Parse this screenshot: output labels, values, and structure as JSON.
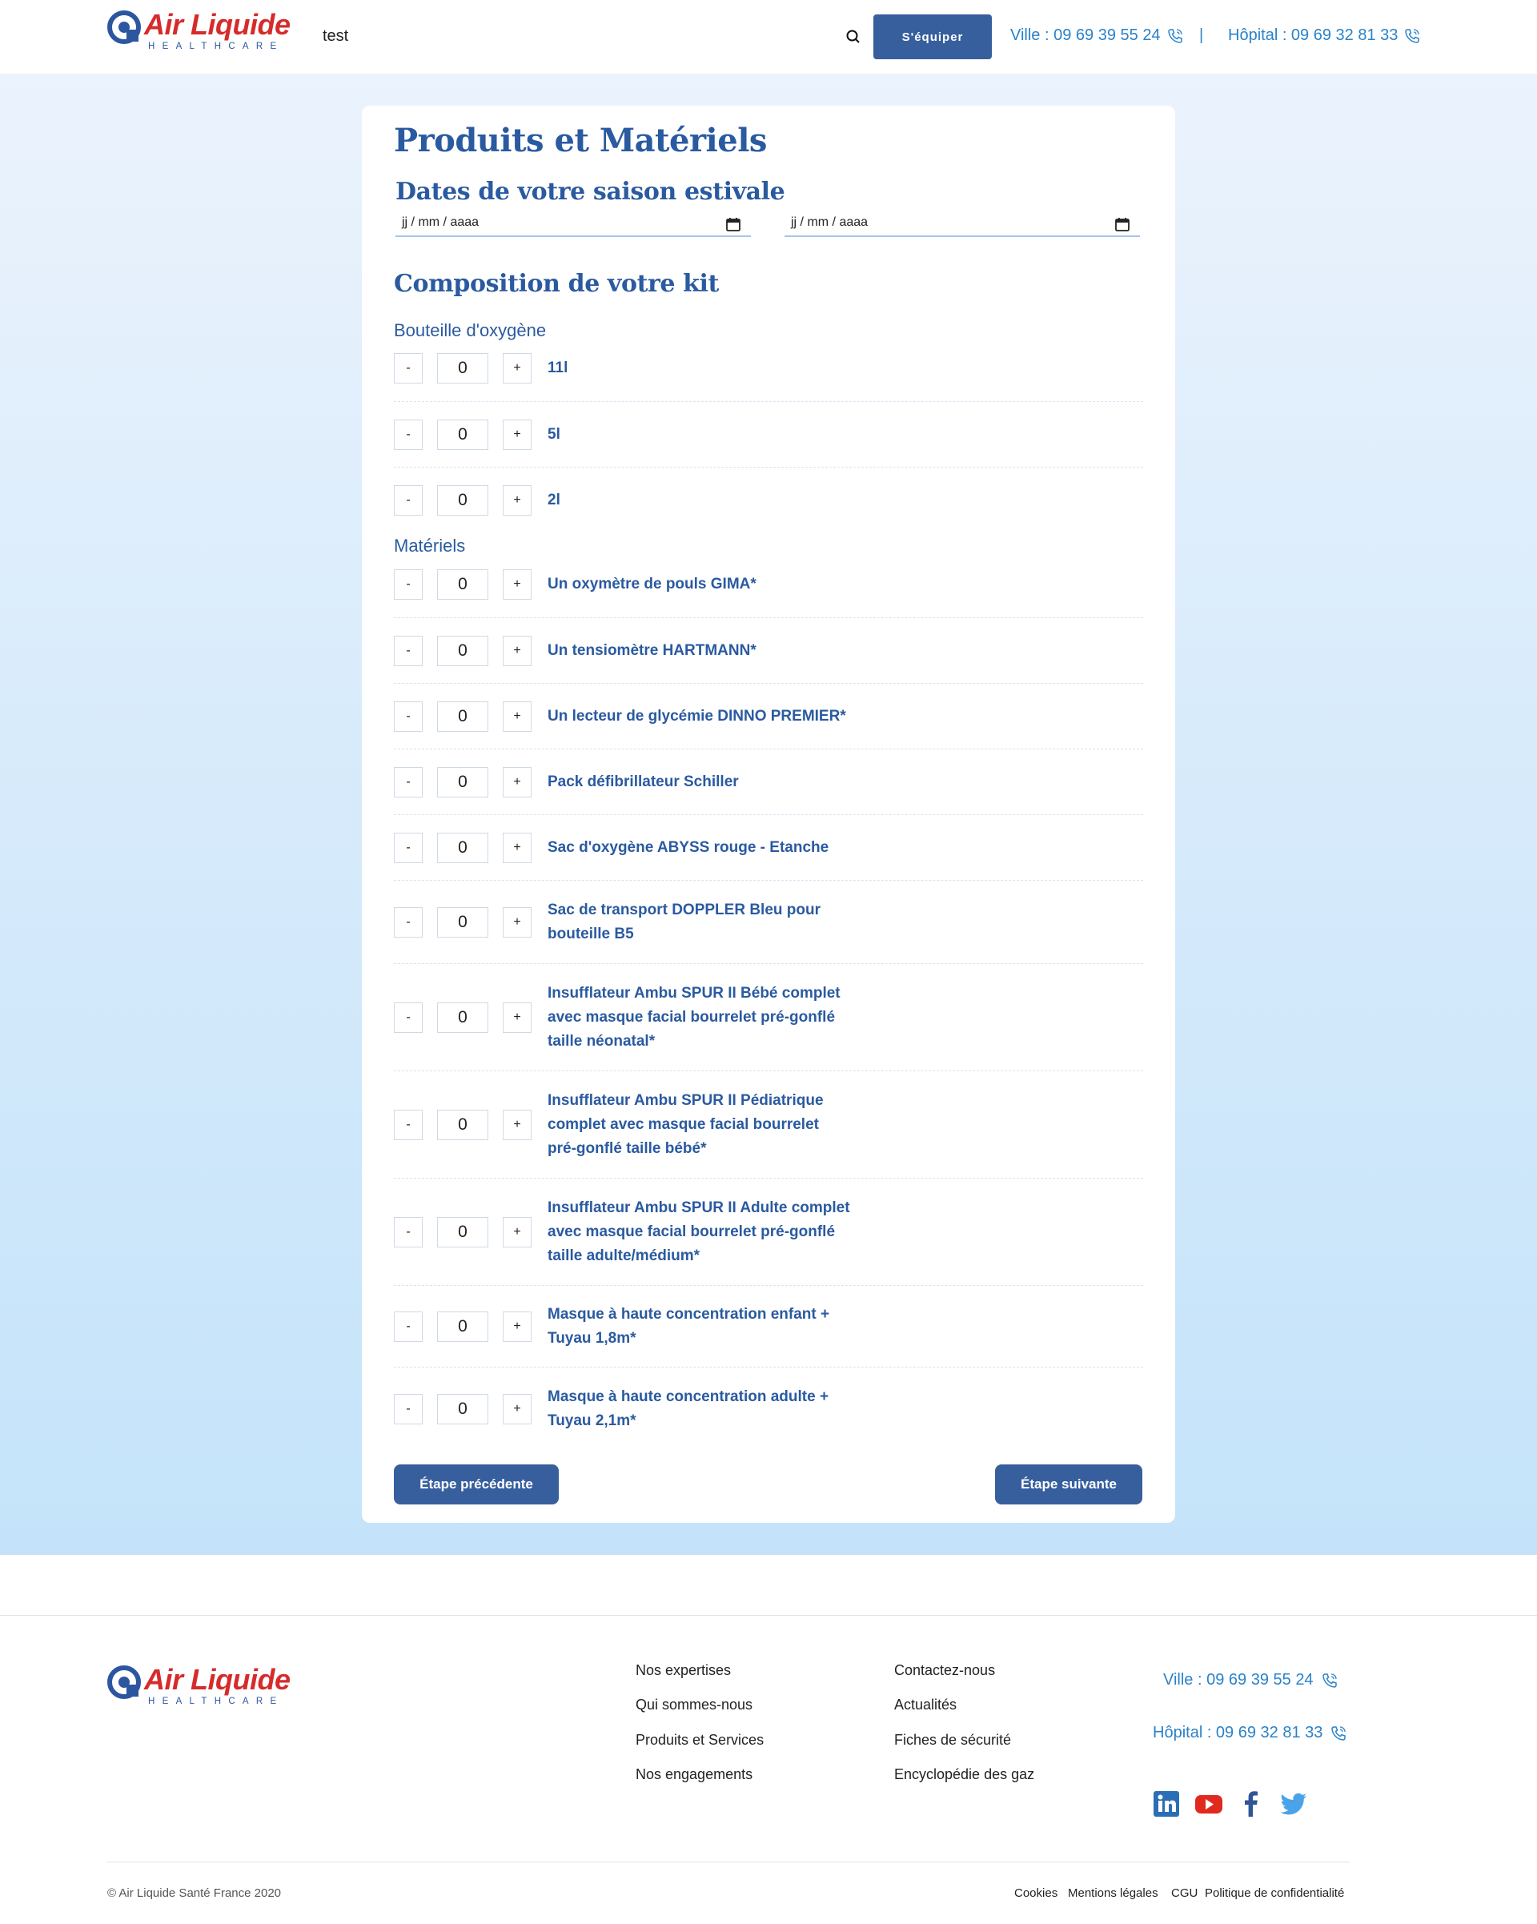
{
  "header": {
    "logo_name": "Air Liquide",
    "logo_sub": "HEALTHCARE",
    "test_label": "test",
    "equip_button": "S'équiper",
    "phone_ville": "Ville : 09 69 39 55 24",
    "separator": "|",
    "phone_hopital": "Hôpital : 09 69 32 81 33"
  },
  "form": {
    "title": "Produits et Matériels",
    "dates_title": "Dates de votre saison estivale",
    "date_start_placeholder": "jj / mm / aaaa",
    "date_end_placeholder": "jj / mm / aaaa",
    "kit_title": "Composition de votre kit",
    "oxygen_group": "Bouteille d'oxygène",
    "materials_group": "Matériels",
    "minus": "-",
    "plus": "+",
    "oxygen": [
      {
        "qty": "0",
        "label": "11l"
      },
      {
        "qty": "0",
        "label": "5l"
      },
      {
        "qty": "0",
        "label": "2l"
      }
    ],
    "materials": [
      {
        "qty": "0",
        "label": "Un oxymètre de pouls GIMA*"
      },
      {
        "qty": "0",
        "label": "Un tensiomètre HARTMANN*"
      },
      {
        "qty": "0",
        "label": "Un lecteur de glycémie DINNO PREMIER*"
      },
      {
        "qty": "0",
        "label": "Pack défibrillateur Schiller"
      },
      {
        "qty": "0",
        "label": "Sac d'oxygène ABYSS rouge - Etanche"
      },
      {
        "qty": "0",
        "label": "Sac de transport DOPPLER Bleu pour bouteille B5"
      },
      {
        "qty": "0",
        "label": "Insufflateur Ambu SPUR II Bébé complet avec masque facial bourrelet pré-gonflé taille néonatal*"
      },
      {
        "qty": "0",
        "label": "Insufflateur Ambu SPUR II Pédiatrique complet avec masque facial bourrelet pré-gonflé taille bébé*"
      },
      {
        "qty": "0",
        "label": "Insufflateur Ambu SPUR II Adulte complet avec masque facial bourrelet pré-gonflé taille adulte/médium*"
      },
      {
        "qty": "0",
        "label": "Masque à haute concentration enfant + Tuyau 1,8m*"
      },
      {
        "qty": "0",
        "label": "Masque à haute concentration adulte + Tuyau 2,1m*"
      }
    ],
    "prev_button": "Étape précédente",
    "next_button": "Étape suivante"
  },
  "footer": {
    "logo_name": "Air Liquide",
    "logo_sub": "HEALTHCARE",
    "col1": [
      "Nos expertises",
      "Qui sommes-nous",
      "Produits et Services",
      "Nos engagements"
    ],
    "col2": [
      "Contactez-nous",
      "Actualités",
      "Fiches de sécurité",
      "Encyclopédie des gaz"
    ],
    "phone_ville": "Ville : 09 69 39 55 24",
    "phone_hopital": "Hôpital : 09 69 32 81 33",
    "social": [
      "linkedin-icon",
      "youtube-icon",
      "facebook-icon",
      "twitter-icon"
    ],
    "copyright": "© Air Liquide Santé France 2020",
    "legal": [
      "Cookies",
      "Mentions légales",
      "CGU",
      "Politique de confidentialité"
    ]
  },
  "colors": {
    "brand_blue": "#375f9e",
    "title_blue": "#2a5aa0",
    "phone_blue": "#2a82c9",
    "logo_red": "#d62b2b"
  }
}
